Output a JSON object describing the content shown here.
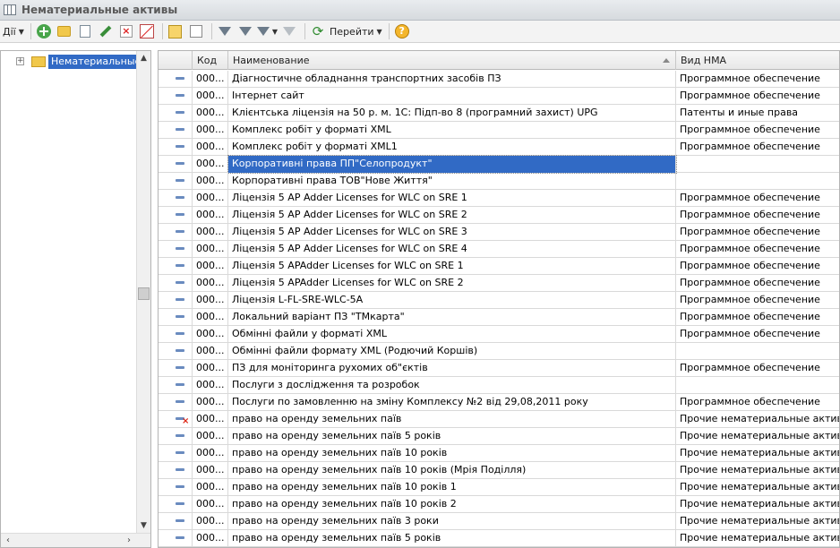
{
  "window": {
    "title": "Нематериальные активы"
  },
  "toolbar": {
    "actions_label": "Дії",
    "goto_label": "Перейти",
    "icons": [
      "add-icon",
      "add-group-icon",
      "copy-icon",
      "edit-icon",
      "delete-icon",
      "mark-deletion-icon",
      "hierarchy-icon",
      "level-up-icon",
      "filter-icon",
      "filter-dropdown-icon",
      "filter-clear-icon",
      "refresh-icon",
      "help-icon"
    ]
  },
  "tree": {
    "expand_symbol": "+",
    "root_label": "Нематериальные а"
  },
  "grid": {
    "columns": {
      "code": "Код",
      "name": "Наименование",
      "type": "Вид НМА"
    },
    "rows": [
      {
        "code": "000...",
        "name": "Діагностичне обладнання транспортних засобів ПЗ",
        "type": "Программное обеспечение"
      },
      {
        "code": "000...",
        "name": "Інтернет сайт",
        "type": "Программное обеспечение"
      },
      {
        "code": "000...",
        "name": "Клієнтська ліцензія на 50 р. м. 1С: Підп-во 8 (програмний захист) UPG",
        "type": "Патенты и иные права"
      },
      {
        "code": "000...",
        "name": "Комплекс робіт у форматі XML",
        "type": "Программное обеспечение"
      },
      {
        "code": "000...",
        "name": "Комплекс робіт у форматі XML1",
        "type": "Программное обеспечение"
      },
      {
        "code": "000...",
        "name": "Корпоративні права ПП\"Селопродукт\"",
        "type": "",
        "selected": true
      },
      {
        "code": "000...",
        "name": "Корпоративні права ТОВ\"Нове Життя\"",
        "type": ""
      },
      {
        "code": "000...",
        "name": "Ліцензія 5 AP Adder Licenses for WLC on SRE 1",
        "type": "Программное обеспечение"
      },
      {
        "code": "000...",
        "name": "Ліцензія 5 AP Adder Licenses for WLC on SRE 2",
        "type": "Программное обеспечение"
      },
      {
        "code": "000...",
        "name": "Ліцензія 5 AP Adder Licenses for WLC on SRE 3",
        "type": "Программное обеспечение"
      },
      {
        "code": "000...",
        "name": "Ліцензія 5 AP Adder Licenses for WLC on SRE 4",
        "type": "Программное обеспечение"
      },
      {
        "code": "000...",
        "name": "Ліцензія 5 APAdder Licenses for WLC on SRE 1",
        "type": "Программное обеспечение"
      },
      {
        "code": "000...",
        "name": "Ліцензія 5 APAdder Licenses for WLC on SRE 2",
        "type": "Программное обеспечение"
      },
      {
        "code": "000...",
        "name": "Ліцензія L-FL-SRE-WLC-5A",
        "type": "Программное обеспечение"
      },
      {
        "code": "000...",
        "name": "Локальний варіант ПЗ \"ТМкарта\"",
        "type": "Программное обеспечение"
      },
      {
        "code": "000...",
        "name": "Обмінні файли у форматі XML",
        "type": "Программное обеспечение"
      },
      {
        "code": "000...",
        "name": "Обмінні файли формату XML (Родючий Коршів)",
        "type": ""
      },
      {
        "code": "000...",
        "name": "ПЗ для моніторинга рухомих об\"єктів",
        "type": "Программное обеспечение"
      },
      {
        "code": "000...",
        "name": "Послуги з дослідження та розробок",
        "type": ""
      },
      {
        "code": "000...",
        "name": "Послуги по замовленню на зміну Комплексу №2 від 29,08,2011 року",
        "type": "Программное обеспечение"
      },
      {
        "code": "000...",
        "name": "право на оренду земельних паїв",
        "type": "Прочие нематериальные активы",
        "deleted": true
      },
      {
        "code": "000...",
        "name": "право на оренду земельних паїв  5 років",
        "type": "Прочие нематериальные активы"
      },
      {
        "code": "000...",
        "name": "право на оренду земельних паїв 10 років",
        "type": "Прочие нематериальные активы"
      },
      {
        "code": "000...",
        "name": "право на оренду земельних паїв 10 років (Мрія Поділля)",
        "type": "Прочие нематериальные активы"
      },
      {
        "code": "000...",
        "name": "право на оренду земельних паїв 10 років 1",
        "type": "Прочие нематериальные активы"
      },
      {
        "code": "000...",
        "name": "право на оренду земельних паїв 10 років 2",
        "type": "Прочие нематериальные активы"
      },
      {
        "code": "000...",
        "name": "право на оренду земельних паїв 3 роки",
        "type": "Прочие нематериальные активы"
      },
      {
        "code": "000...",
        "name": "право на оренду земельних паїв 5 років",
        "type": "Прочие нематериальные активы"
      }
    ]
  },
  "colors": {
    "selection": "#316ac5",
    "row_icon": "#6a8bbf",
    "deletion_mark": "#d21111"
  }
}
